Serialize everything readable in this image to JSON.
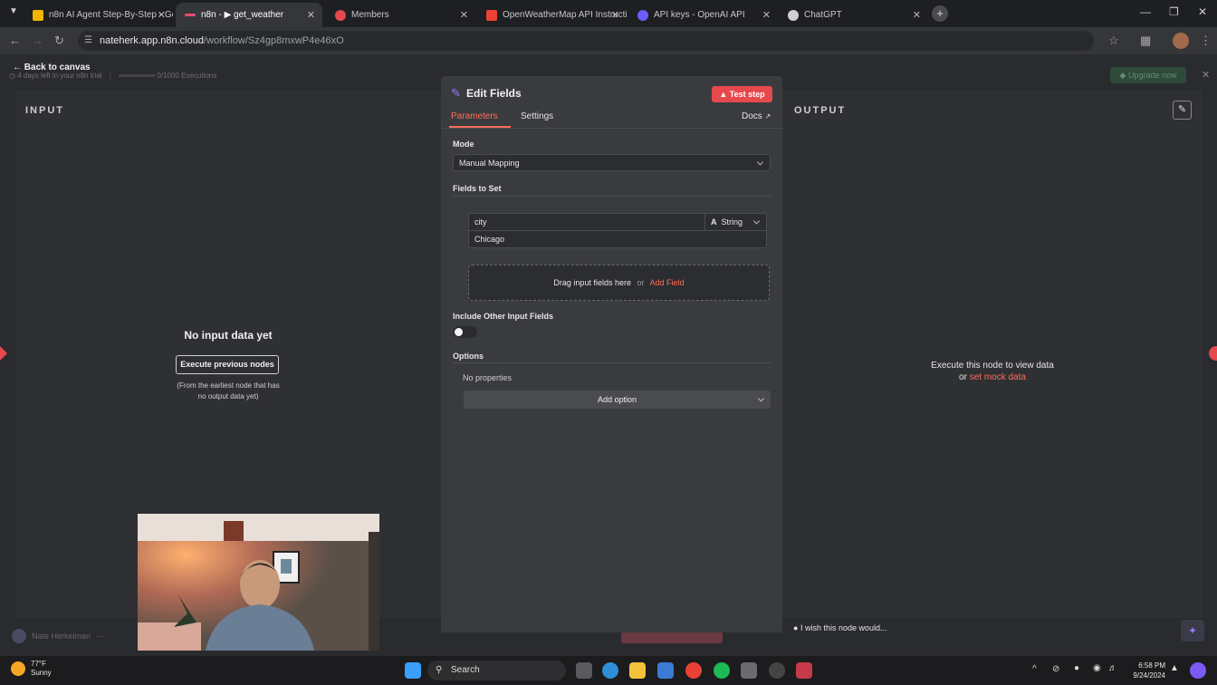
{
  "browser": {
    "tabs": [
      {
        "label": "n8n AI Agent Step-By-Step - Go",
        "color": "#f4b400"
      },
      {
        "label": "n8n - ▶ get_weather",
        "color": "#ea4b71"
      },
      {
        "label": "Members",
        "color": "#e5484d"
      },
      {
        "label": "OpenWeatherMap API Instructi",
        "color": "#ea4335"
      },
      {
        "label": "API keys - OpenAI API",
        "color": "#6b5cff"
      },
      {
        "label": "ChatGPT",
        "color": "#cfcfcf"
      }
    ],
    "url_host": "nateherk.app.n8n.cloud",
    "url_path": "/workflow/Sz4gp8mxwP4e46xO"
  },
  "app": {
    "back_label": "Back to canvas",
    "trial_text": "4 days left in your n8n trial",
    "executions_text": "0/1000 Executions",
    "upgrade_label": "Upgrade now",
    "user_name": "Nate Herkelman",
    "wish_text": "I wish this node would..."
  },
  "input": {
    "title": "INPUT",
    "empty_title": "No input data yet",
    "execute_label": "Execute previous nodes",
    "note_line1": "(From the earliest node that has",
    "note_line2": "no output data yet)"
  },
  "output": {
    "title": "OUTPUT",
    "message": "Execute this node to view data",
    "or_text": "or",
    "mock_link": "set mock data"
  },
  "panel": {
    "title": "Edit Fields",
    "test_label": "Test step",
    "tabs": {
      "parameters": "Parameters",
      "settings": "Settings",
      "docs": "Docs"
    },
    "mode_label": "Mode",
    "mode_value": "Manual Mapping",
    "fields_label": "Fields to Set",
    "field_name": "city",
    "field_type": "String",
    "field_value": "Chicago",
    "drag_text": "Drag input fields here",
    "drag_or": "or",
    "add_field": "Add Field",
    "include_label": "Include Other Input Fields",
    "options_label": "Options",
    "no_props": "No properties",
    "add_option": "Add option"
  },
  "taskbar": {
    "temp": "77°F",
    "weather": "Sunny",
    "search": "Search",
    "time": "6:58 PM",
    "date": "9/24/2024"
  },
  "colors": {
    "accent": "#ea4b71",
    "link": "#ff6d5a",
    "upgrade": "#2e8b57"
  }
}
